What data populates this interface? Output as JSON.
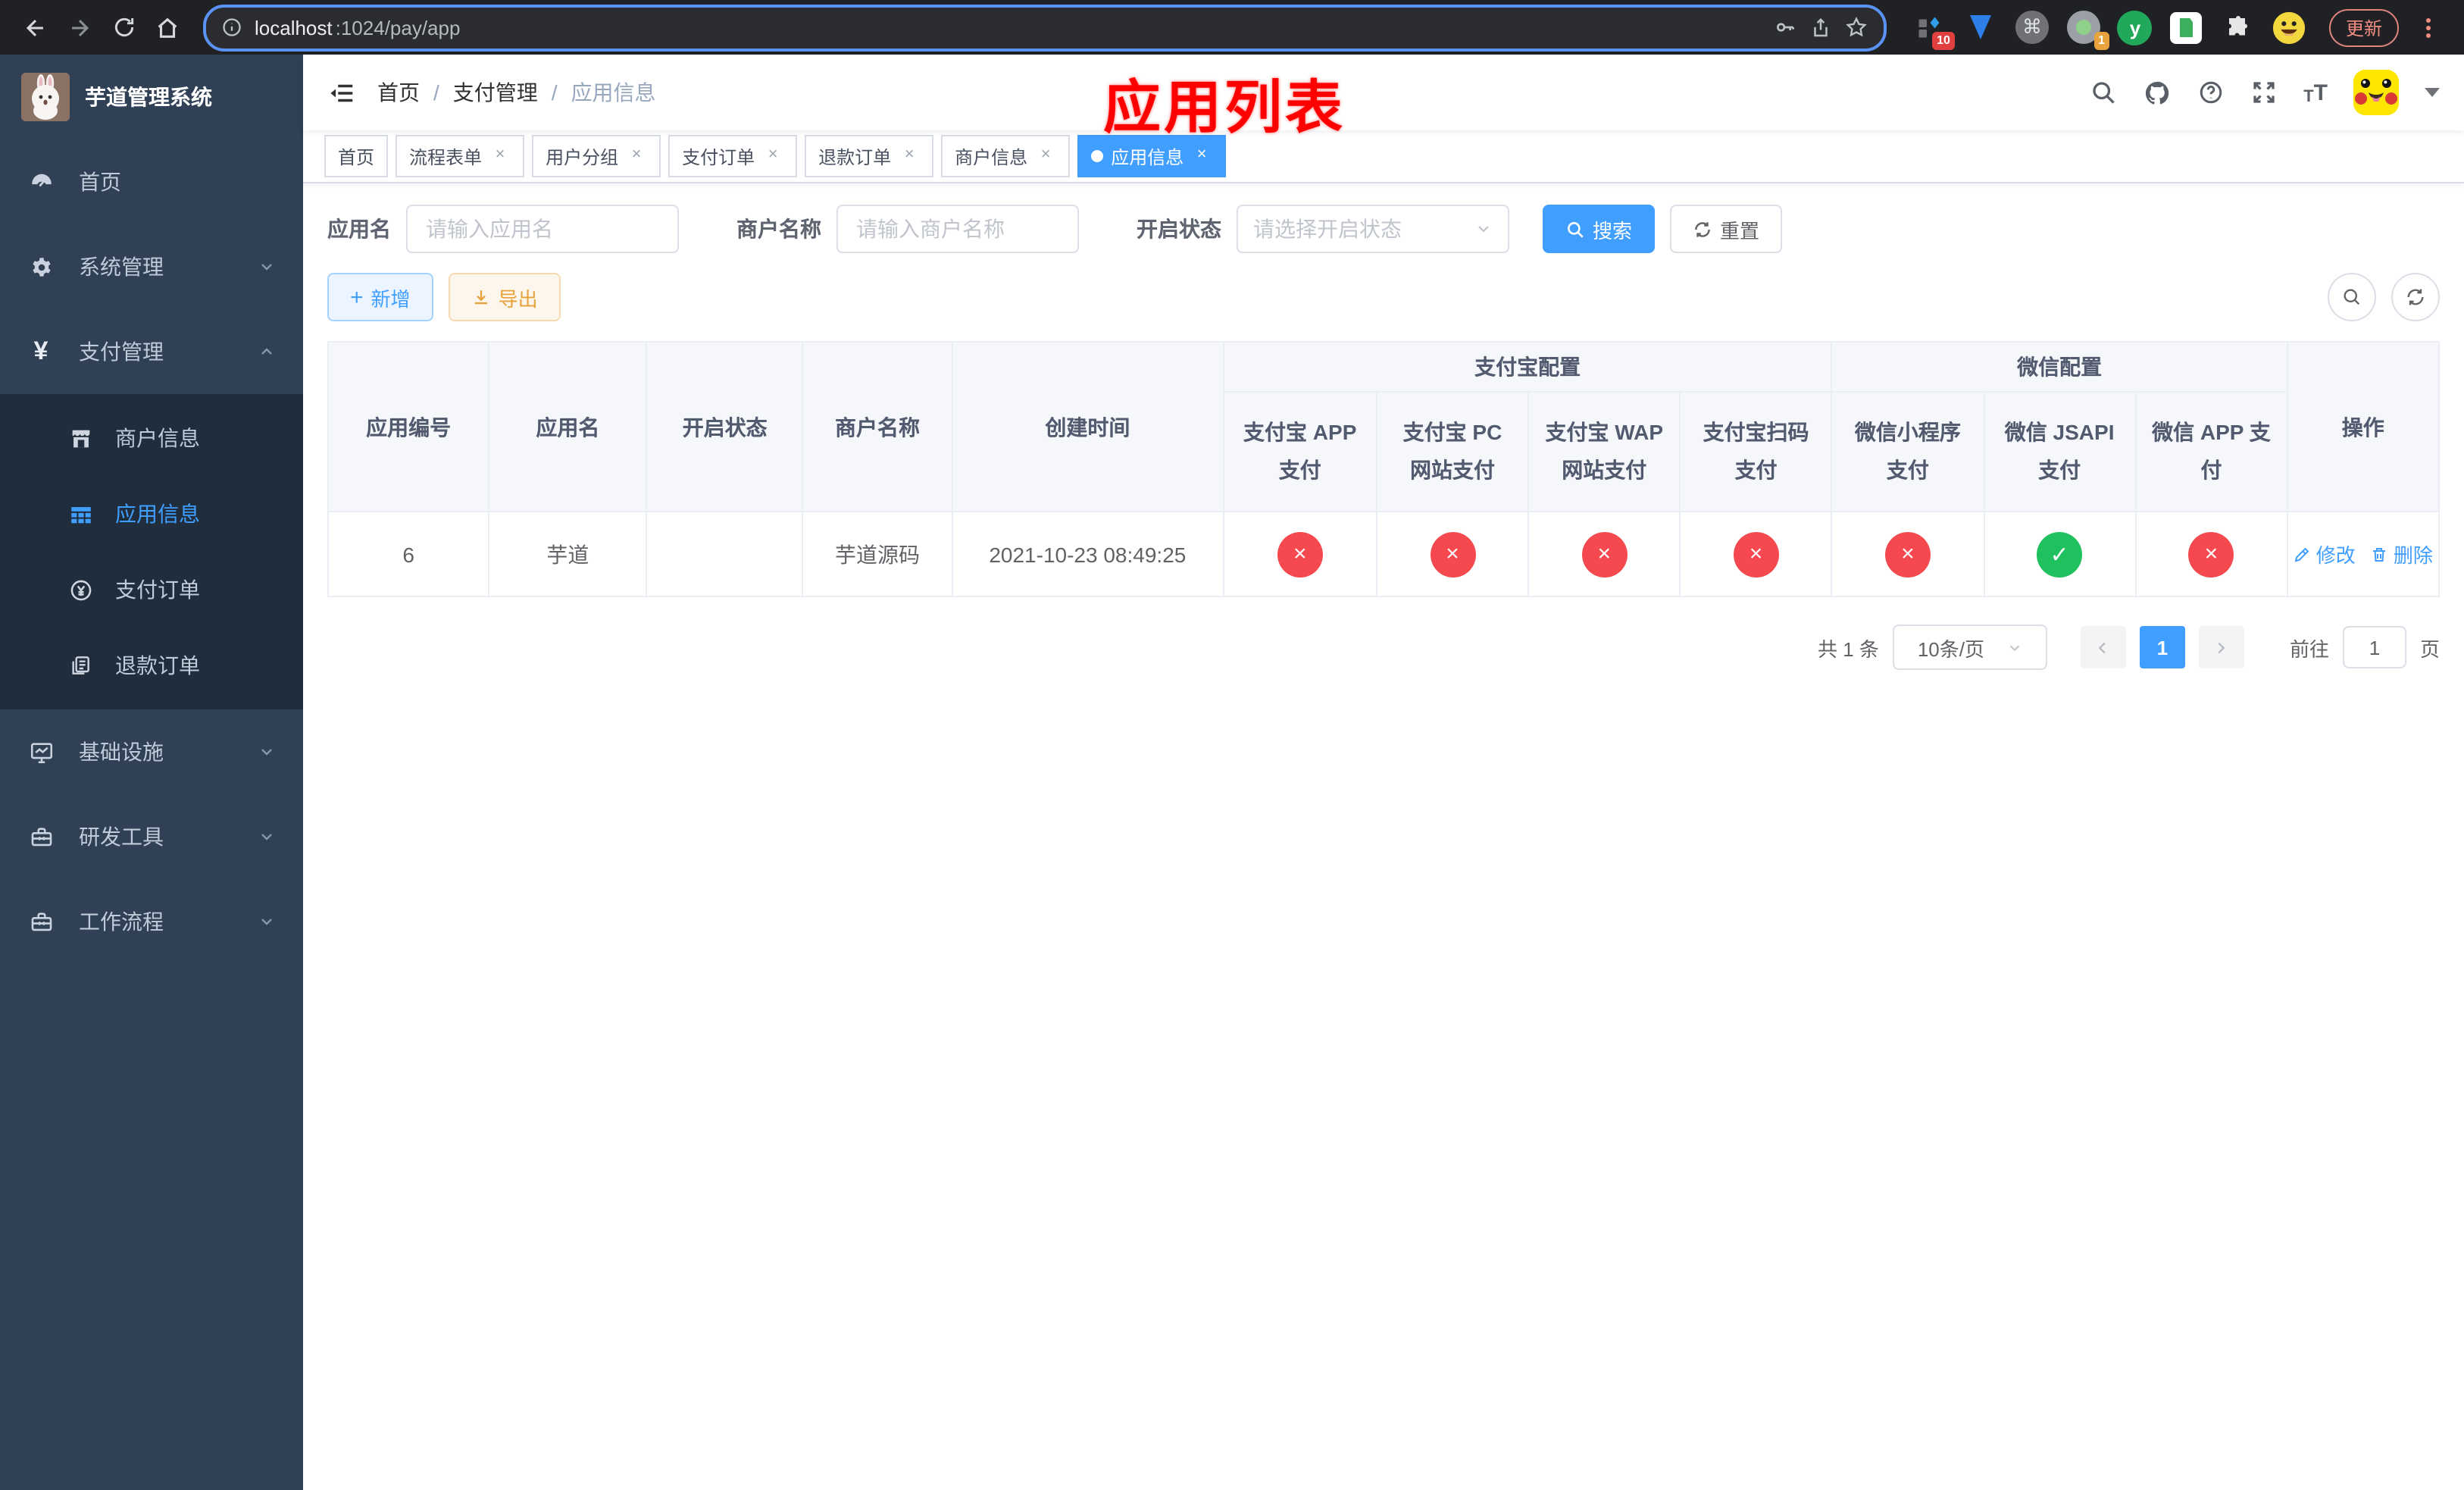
{
  "colors": {
    "accent": "#409eff",
    "danger": "#f5494f",
    "success": "#1fc05e",
    "annotation": "#ff0000",
    "sidebar_bg": "#304156",
    "submenu_bg": "#1f2d3d"
  },
  "icons": {
    "close": "×",
    "check": "✓",
    "cross": "×",
    "plus": "+",
    "command": "⌘",
    "letter_y": "y"
  },
  "browser": {
    "url_host": "localhost",
    "url_rest": ":1024/pay/app",
    "update_label": "更新",
    "ext_badge_a": "10",
    "ext_badge_b": "1"
  },
  "sidebar": {
    "title": "芋道管理系统",
    "menu": [
      {
        "label": "首页"
      },
      {
        "label": "系统管理"
      },
      {
        "label": "支付管理"
      },
      {
        "label": "基础设施"
      },
      {
        "label": "研发工具"
      },
      {
        "label": "工作流程"
      }
    ],
    "submenu": [
      {
        "label": "商户信息"
      },
      {
        "label": "应用信息"
      },
      {
        "label": "支付订单"
      },
      {
        "label": "退款订单"
      }
    ]
  },
  "navbar": {
    "breadcrumb": [
      "首页",
      "支付管理",
      "应用信息"
    ]
  },
  "annotation": {
    "text": "应用列表"
  },
  "tabs": [
    {
      "label": "首页",
      "closable": false,
      "active": false
    },
    {
      "label": "流程表单",
      "closable": true,
      "active": false
    },
    {
      "label": "用户分组",
      "closable": true,
      "active": false
    },
    {
      "label": "支付订单",
      "closable": true,
      "active": false
    },
    {
      "label": "退款订单",
      "closable": true,
      "active": false
    },
    {
      "label": "商户信息",
      "closable": true,
      "active": false
    },
    {
      "label": "应用信息",
      "closable": true,
      "active": true
    }
  ],
  "filter": {
    "app_name_label": "应用名",
    "app_name_placeholder": "请输入应用名",
    "merchant_label": "商户名称",
    "merchant_placeholder": "请输入商户名称",
    "status_label": "开启状态",
    "status_placeholder": "请选择开启状态",
    "search_label": "搜索",
    "reset_label": "重置"
  },
  "toolbar": {
    "add_label": "新增",
    "export_label": "导出"
  },
  "table": {
    "plain_headers": [
      "应用编号",
      "应用名",
      "开启状态",
      "商户名称",
      "创建时间"
    ],
    "groups": [
      {
        "label": "支付宝配置",
        "children": [
          "支付宝 APP 支付",
          "支付宝 PC 网站支付",
          "支付宝 WAP 网站支付",
          "支付宝扫码支付"
        ]
      },
      {
        "label": "微信配置",
        "children": [
          "微信小程序支付",
          "微信 JSAPI 支付",
          "微信 APP 支付"
        ]
      }
    ],
    "action_header": "操作",
    "row": {
      "id": "6",
      "name": "芋道",
      "enabled": true,
      "merchant": "芋道源码",
      "created_at": "2021-10-23 08:49:25",
      "statuses": [
        false,
        false,
        false,
        false,
        false,
        true,
        false
      ],
      "edit_label": "修改",
      "delete_label": "删除"
    }
  },
  "pagination": {
    "total_text": "共 1 条",
    "page_size": "10条/页",
    "current_page": "1",
    "goto_label": "前往",
    "goto_value": "1",
    "page_unit": "页"
  }
}
